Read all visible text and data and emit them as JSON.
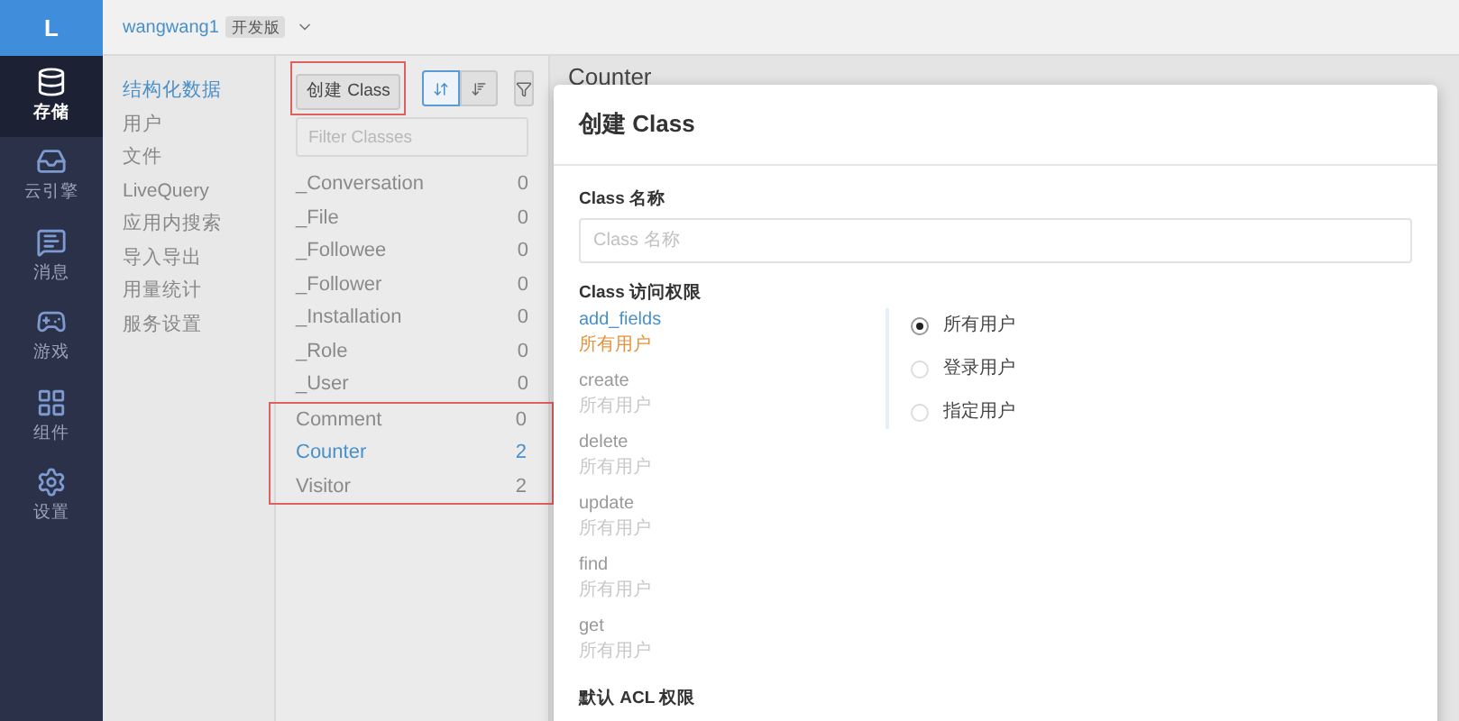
{
  "app": {
    "logo": "L",
    "workspace": "wangwang1",
    "badge": "开发版"
  },
  "rail": [
    {
      "kind": "database",
      "label": "存储",
      "selected": true
    },
    {
      "kind": "tray",
      "label": "云引擎",
      "selected": false
    },
    {
      "kind": "message",
      "label": "消息",
      "selected": false
    },
    {
      "kind": "gamepad",
      "label": "游戏",
      "selected": false
    },
    {
      "kind": "grid",
      "label": "组件",
      "selected": false
    },
    {
      "kind": "settings",
      "label": "设置",
      "selected": false
    }
  ],
  "menu": [
    {
      "label": "结构化数据",
      "selected": true
    },
    {
      "label": "用户",
      "selected": false
    },
    {
      "label": "文件",
      "selected": false
    },
    {
      "label": "LiveQuery",
      "selected": false
    },
    {
      "label": "应用内搜索",
      "selected": false
    },
    {
      "label": "导入导出",
      "selected": false
    },
    {
      "label": "用量统计",
      "selected": false
    },
    {
      "label": "服务设置",
      "selected": false
    }
  ],
  "toolbar": {
    "create_button": "创建 Class",
    "create_annotated": true,
    "sort_buttons": [
      {
        "kind": "name",
        "selected": true
      },
      {
        "kind": "count",
        "selected": false
      }
    ],
    "filter_placeholder": "Filter Classes"
  },
  "classes": [
    {
      "name": "_Conversation",
      "count": "0",
      "selected": false,
      "annotated": false
    },
    {
      "name": "_File",
      "count": "0",
      "selected": false,
      "annotated": false
    },
    {
      "name": "_Followee",
      "count": "0",
      "selected": false,
      "annotated": false
    },
    {
      "name": "_Follower",
      "count": "0",
      "selected": false,
      "annotated": false
    },
    {
      "name": "_Installation",
      "count": "0",
      "selected": false,
      "annotated": false
    },
    {
      "name": "_Role",
      "count": "0",
      "selected": false,
      "annotated": false
    },
    {
      "name": "_User",
      "count": "0",
      "selected": false,
      "annotated": false
    },
    {
      "name": "Comment",
      "count": "0",
      "selected": false,
      "annotated": true
    },
    {
      "name": "Counter",
      "count": "2",
      "selected": true,
      "annotated": true
    },
    {
      "name": "Visitor",
      "count": "2",
      "selected": false,
      "annotated": true
    }
  ],
  "main": {
    "title": "Counter"
  },
  "dialog": {
    "title": "创建 Class",
    "name_label": "Class 名称",
    "name_placeholder": "Class 名称",
    "acl_label": "Class 访问权限",
    "permissions": [
      {
        "name": "add_fields",
        "value": "所有用户",
        "selected": true
      },
      {
        "name": "create",
        "value": "所有用户",
        "selected": false
      },
      {
        "name": "delete",
        "value": "所有用户",
        "selected": false
      },
      {
        "name": "update",
        "value": "所有用户",
        "selected": false
      },
      {
        "name": "find",
        "value": "所有用户",
        "selected": false
      },
      {
        "name": "get",
        "value": "所有用户",
        "selected": false
      }
    ],
    "options": [
      {
        "label": "所有用户",
        "selected": true
      },
      {
        "label": "登录用户",
        "selected": false
      },
      {
        "label": "指定用户",
        "selected": false
      }
    ],
    "default_acl_label": "默认 ACL 权限"
  }
}
